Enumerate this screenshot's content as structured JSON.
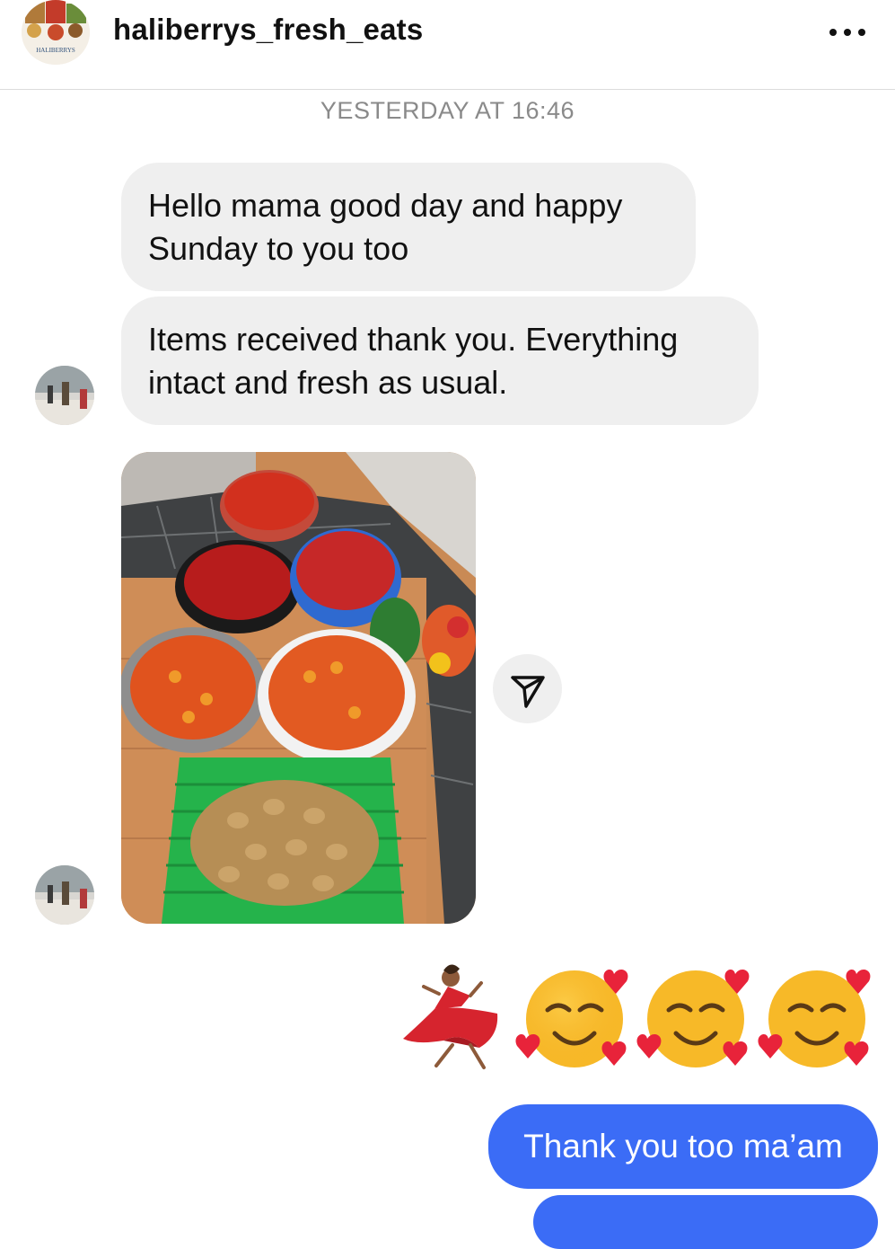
{
  "header": {
    "username": "haliberrys_fresh_eats",
    "avatar_icon": "haliberrys-logo-avatar",
    "avatar_logo_text": "HALIBERRYS",
    "more_icon": "more-horizontal-icon"
  },
  "thread": {
    "timestamp": "YESTERDAY AT 16:46",
    "messages": [
      {
        "from": "them",
        "text": "Hello mama good day and happy Sunday to you too"
      },
      {
        "from": "them",
        "text": "Items received thank you. Everything intact and fresh as usual."
      },
      {
        "from": "them",
        "type": "photo",
        "content": "bowls of peppers, tomatoes and a basket of potatoes"
      },
      {
        "from": "me",
        "type": "emoji",
        "content": "💃🥰🥰🥰"
      },
      {
        "from": "me",
        "text": "Thank you too ma’am"
      }
    ],
    "share_icon": "share-send-icon"
  },
  "colors": {
    "outgoing_bubble": "#3b6cf6",
    "incoming_bubble": "#efefef",
    "timestamp": "#8a8a8a"
  }
}
